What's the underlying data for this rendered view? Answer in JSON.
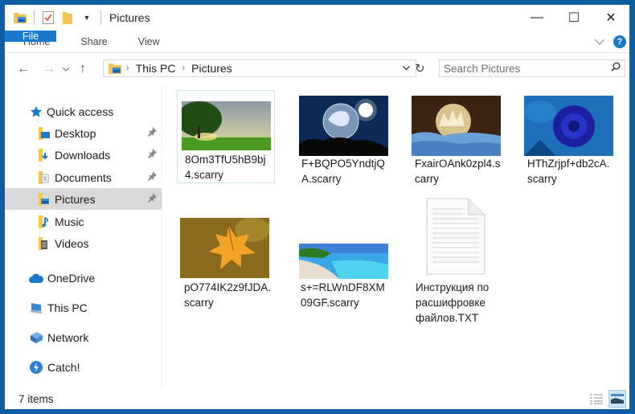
{
  "window": {
    "title": "Pictures",
    "controls": {
      "minimize": "—",
      "maximize": "☐",
      "close": "✕"
    }
  },
  "ribbon": {
    "tabs": [
      {
        "label": "File",
        "active": true
      },
      {
        "label": "Home"
      },
      {
        "label": "Share"
      },
      {
        "label": "View"
      }
    ],
    "expand_icon": "chevron-down-icon",
    "help_label": "?"
  },
  "navigation": {
    "back": "←",
    "forward": "→",
    "recent": "⌄",
    "up": "↑",
    "breadcrumb": [
      "This PC",
      "Pictures"
    ],
    "refresh": "↻",
    "dropdown": "⌄"
  },
  "search": {
    "placeholder": "Search Pictures"
  },
  "sidebar": {
    "items": [
      {
        "label": "Quick access",
        "icon": "star-icon",
        "pinned": false
      },
      {
        "label": "Desktop",
        "icon": "desktop-folder-icon",
        "pinned": true
      },
      {
        "label": "Downloads",
        "icon": "downloads-folder-icon",
        "pinned": true
      },
      {
        "label": "Documents",
        "icon": "documents-folder-icon",
        "pinned": true
      },
      {
        "label": "Pictures",
        "icon": "pictures-folder-icon",
        "pinned": true,
        "selected": true
      },
      {
        "label": "Music",
        "icon": "music-folder-icon",
        "pinned": false
      },
      {
        "label": "Videos",
        "icon": "videos-folder-icon",
        "pinned": false
      },
      {
        "label": "OneDrive",
        "icon": "onedrive-icon",
        "pinned": false
      },
      {
        "label": "This PC",
        "icon": "this-pc-icon",
        "pinned": false
      },
      {
        "label": "Network",
        "icon": "network-icon",
        "pinned": false
      },
      {
        "label": "Catch!",
        "icon": "catch-icon",
        "pinned": false
      }
    ],
    "pin_glyph": "📌"
  },
  "files": [
    {
      "name_line1": "8Om3TfU5hB9bj",
      "name_line2": "4.scarry",
      "thumb": "tree-sunset"
    },
    {
      "name_line1": "F+BQPO5YndtjQ",
      "name_line2": "A.scarry",
      "thumb": "frozen-bubble-night"
    },
    {
      "name_line1": "FxairOAnk0zpl4.s",
      "name_line2": "carry",
      "thumb": "frozen-bubble-snow"
    },
    {
      "name_line1": "HThZrjpf+db2cA.",
      "name_line2": "scarry",
      "thumb": "blue-rose"
    },
    {
      "name_line1": "pO774IK2z9fJDA.",
      "name_line2": "scarry",
      "thumb": "autumn-leaf"
    },
    {
      "name_line1": "s+=RLWnDF8XM",
      "name_line2": "09GF.scarry",
      "thumb": "beach"
    },
    {
      "name_line1": "Инструкция по",
      "name_line2": "расшифровке",
      "name_line3": "файлов.TXT",
      "thumb": "text-document"
    }
  ],
  "status": {
    "item_count": "7 items"
  }
}
